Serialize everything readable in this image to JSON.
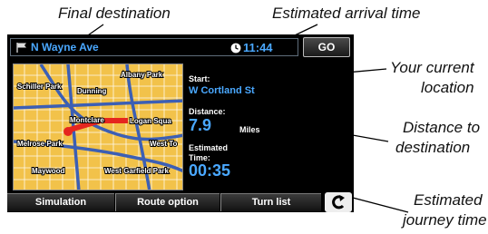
{
  "callouts": {
    "final_destination": "Final destination",
    "estimated_arrival_time": "Estimated arrival time",
    "your_current_location_line1": "Your current",
    "your_current_location_line2": "location",
    "distance_line1": "Distance to",
    "distance_line2": "destination",
    "journey_time_line1": "Estimated",
    "journey_time_line2": "journey time"
  },
  "topbar": {
    "destination": "N Wayne Ave",
    "arrival_time": "11:44",
    "go_label": "GO"
  },
  "map": {
    "labels": {
      "albany_park": "Albany Park",
      "schiller_park": "Schiller Park",
      "dunning": "Dunning",
      "montclare": "Montclare",
      "logan_square": "Logan Squa",
      "melrose_park": "Melrose Park",
      "west_town": "West To",
      "maywood": "Maywood",
      "west_garfield_park": "West Garfield Park"
    }
  },
  "info": {
    "start_label": "Start:",
    "start_value": "W Cortland St",
    "distance_label": "Distance:",
    "distance_value": "7.9",
    "distance_unit": "Miles",
    "estimated_time_label_line1": "Estimated",
    "estimated_time_label_line2": "Time:",
    "estimated_time_value": "00:35"
  },
  "bottombar": {
    "simulation_label": "Simulation",
    "route_option_label": "Route option",
    "turn_list_label": "Turn list"
  },
  "colors": {
    "accent_blue": "#4aa8ff",
    "map_yellow": "#f2c24a",
    "route_red": "#e5261f"
  }
}
